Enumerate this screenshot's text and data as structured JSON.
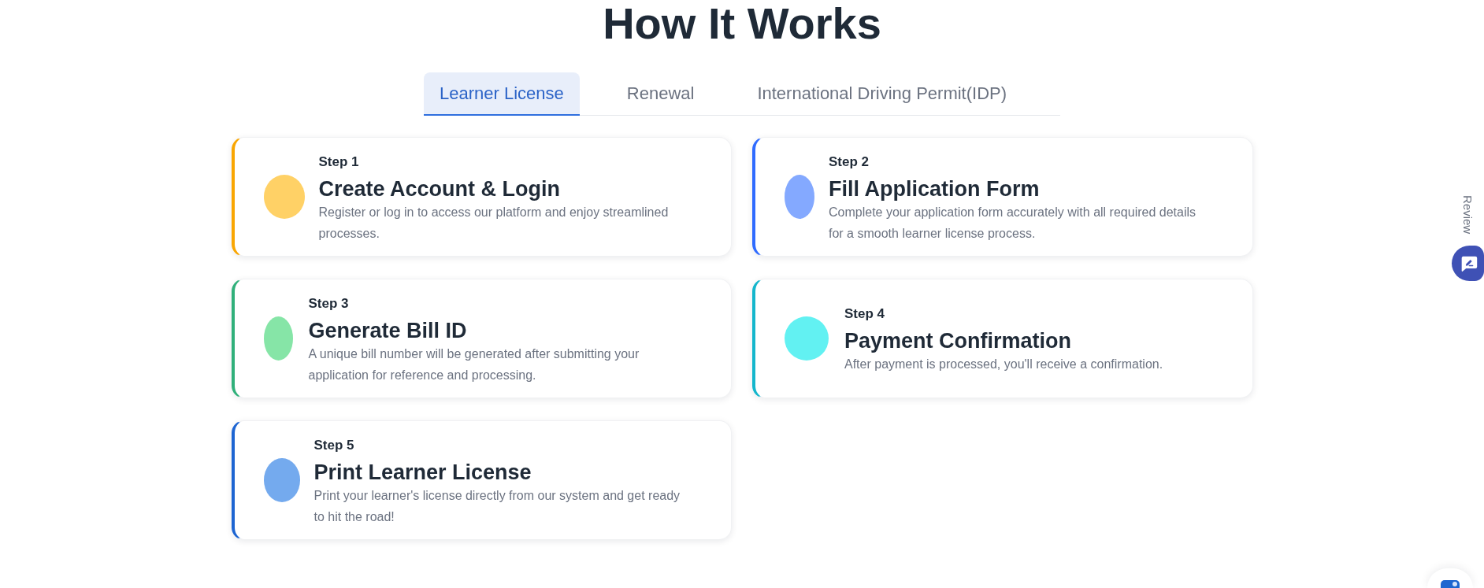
{
  "title": "How It Works",
  "tabs": [
    {
      "label": "Learner License",
      "selected": true
    },
    {
      "label": "Renewal",
      "selected": false
    },
    {
      "label": "International Driving Permit(IDP)",
      "selected": false
    }
  ],
  "steps": [
    {
      "step": "Step 1",
      "title": "Create Account & Login",
      "description": "Register or log in to access our platform and enjoy streamlined processes.",
      "color": "#f9a602",
      "marker": {
        "color": "#ffd166"
      }
    },
    {
      "step": "Step 2",
      "title": "Fill Application Form",
      "description": "Complete your application form accurately with all required details for a smooth learner license process.",
      "color": "#2f6bff",
      "marker": {
        "color": "#84a9ff"
      }
    },
    {
      "step": "Step 3",
      "title": "Generate Bill ID",
      "description": "A unique bill number will be generated after submitting your application for reference and processing.",
      "color": "#30b07a",
      "marker": {
        "color": "#86e5a7"
      }
    },
    {
      "step": "Step 4",
      "title": "Payment Confirmation",
      "description": "After payment is processed, you'll receive a confirmation.",
      "color": "#14b6cc",
      "marker": {
        "color": "#62f1f2"
      }
    },
    {
      "step": "Step 5",
      "title": "Print Learner License",
      "description": "Print your learner's license directly from our system and get ready to hit the road!",
      "color": "#1d65d2",
      "marker": {
        "color": "#74aaee"
      }
    }
  ],
  "review_widget": {
    "label": "Review"
  },
  "toggle": {
    "on": true
  }
}
